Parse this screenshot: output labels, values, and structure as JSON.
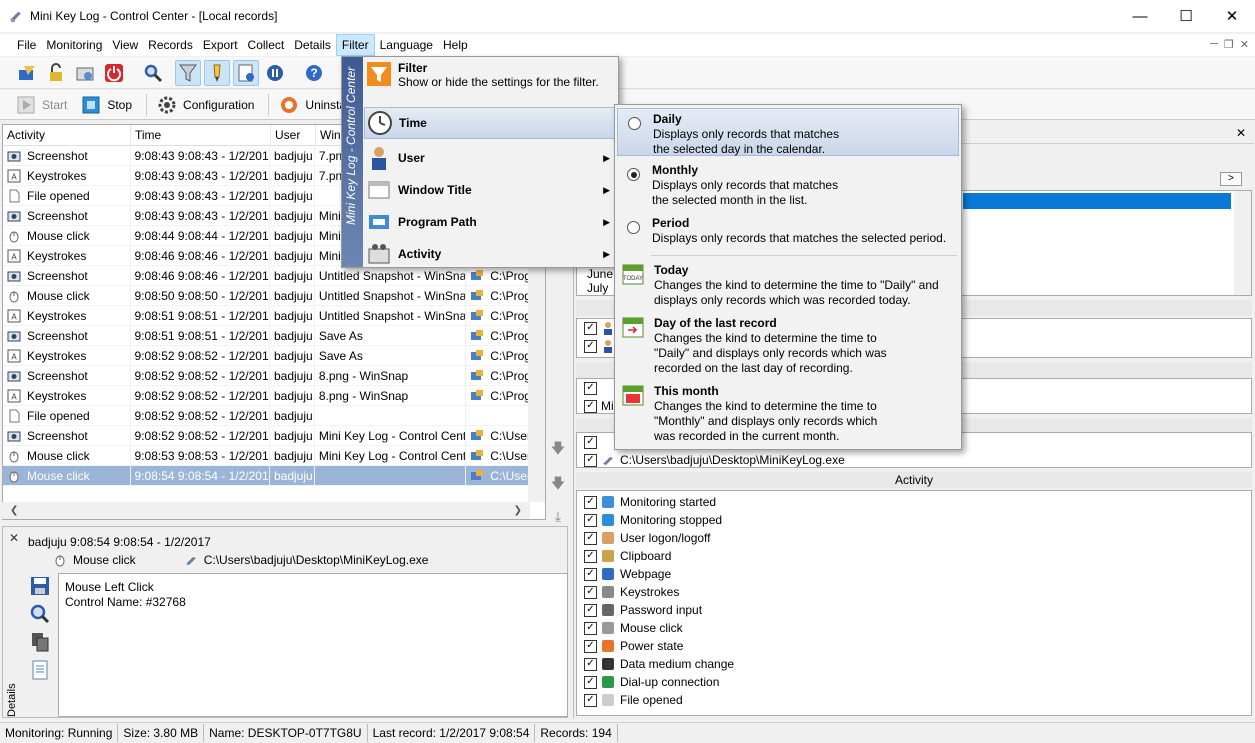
{
  "window": {
    "title": "Mini Key Log - Control Center - [Local records]"
  },
  "menubar": [
    "File",
    "Monitoring",
    "View",
    "Records",
    "Export",
    "Collect",
    "Details",
    "Filter",
    "Language",
    "Help"
  ],
  "toolbar2": {
    "start": "Start",
    "stop": "Stop",
    "configuration": "Configuration",
    "uninstall": "Uninsta"
  },
  "records": {
    "columns": [
      "Activity",
      "Time",
      "User",
      "Win"
    ],
    "rows": [
      {
        "activity": "Screenshot",
        "icon": "screenshot",
        "time": "9:08:43 9:08:43 - 1/2/2017",
        "user": "badjuju",
        "window": "7.pn",
        "path": ""
      },
      {
        "activity": "Keystrokes",
        "icon": "keystrokes",
        "time": "9:08:43 9:08:43 - 1/2/2017",
        "user": "badjuju",
        "window": "7.pn",
        "path": ""
      },
      {
        "activity": "File opened",
        "icon": "file",
        "time": "9:08:43 9:08:43 - 1/2/2017",
        "user": "badjuju",
        "window": "",
        "path": ""
      },
      {
        "activity": "Screenshot",
        "icon": "screenshot",
        "time": "9:08:43 9:08:43 - 1/2/2017",
        "user": "badjuju",
        "window": "Mini",
        "path": ""
      },
      {
        "activity": "Mouse click",
        "icon": "mouse",
        "time": "9:08:44 9:08:44 - 1/2/2017",
        "user": "badjuju",
        "window": "Mini",
        "path": ""
      },
      {
        "activity": "Keystrokes",
        "icon": "keystrokes",
        "time": "9:08:46 9:08:46 - 1/2/2017",
        "user": "badjuju",
        "window": "Mini",
        "path": ""
      },
      {
        "activity": "Screenshot",
        "icon": "screenshot",
        "time": "9:08:46 9:08:46 - 1/2/2017",
        "user": "badjuju",
        "window": "Untitled Snapshot - WinSnap",
        "path": "C:\\Prog"
      },
      {
        "activity": "Mouse click",
        "icon": "mouse",
        "time": "9:08:50 9:08:50 - 1/2/2017",
        "user": "badjuju",
        "window": "Untitled Snapshot - WinSnap",
        "path": "C:\\Prog"
      },
      {
        "activity": "Keystrokes",
        "icon": "keystrokes",
        "time": "9:08:51 9:08:51 - 1/2/2017",
        "user": "badjuju",
        "window": "Untitled Snapshot - WinSnap",
        "path": "C:\\Prog"
      },
      {
        "activity": "Screenshot",
        "icon": "screenshot",
        "time": "9:08:51 9:08:51 - 1/2/2017",
        "user": "badjuju",
        "window": "Save As",
        "path": "C:\\Prog"
      },
      {
        "activity": "Keystrokes",
        "icon": "keystrokes",
        "time": "9:08:52 9:08:52 - 1/2/2017",
        "user": "badjuju",
        "window": "Save As",
        "path": "C:\\Prog"
      },
      {
        "activity": "Screenshot",
        "icon": "screenshot",
        "time": "9:08:52 9:08:52 - 1/2/2017",
        "user": "badjuju",
        "window": "8.png - WinSnap",
        "path": "C:\\Prog"
      },
      {
        "activity": "Keystrokes",
        "icon": "keystrokes",
        "time": "9:08:52 9:08:52 - 1/2/2017",
        "user": "badjuju",
        "window": "8.png - WinSnap",
        "path": "C:\\Prog"
      },
      {
        "activity": "File opened",
        "icon": "file",
        "time": "9:08:52 9:08:52 - 1/2/2017",
        "user": "badjuju",
        "window": "",
        "path": ""
      },
      {
        "activity": "Screenshot",
        "icon": "screenshot",
        "time": "9:08:52 9:08:52 - 1/2/2017",
        "user": "badjuju",
        "window": "Mini Key Log - Control Cent",
        "path": "C:\\User"
      },
      {
        "activity": "Mouse click",
        "icon": "mouse",
        "time": "9:08:53 9:08:53 - 1/2/2017",
        "user": "badjuju",
        "window": "Mini Key Log - Control Cent",
        "path": "C:\\User"
      },
      {
        "activity": "Mouse click",
        "icon": "mouse",
        "time": "9:08:54 9:08:54 - 1/2/2017",
        "user": "badjuju",
        "window": "",
        "path": "C:\\User"
      }
    ]
  },
  "details": {
    "line1": "badjuju   9:08:54 9:08:54  - 1/2/2017",
    "activity": "Mouse click",
    "path": "C:\\Users\\badjuju\\Desktop\\MiniKeyLog.exe",
    "body_line1": "Mouse Left Click",
    "body_line2": "Control Name: #32768",
    "tab": "Details"
  },
  "filter_menu": {
    "band": "Mini Key Log - Control Center",
    "header_title": "Filter",
    "header_sub": "Show or hide the settings for the filter.",
    "items": [
      "Time",
      "User",
      "Window Title",
      "Program Path",
      "Activity"
    ]
  },
  "time_menu": {
    "items": [
      {
        "title": "Daily",
        "sub1": "Displays only records that matches",
        "sub2": "the selected day in the calendar.",
        "sub3": ""
      },
      {
        "title": "Monthly",
        "sub1": "Displays only records that matches",
        "sub2": "the selected month in the list.",
        "sub3": ""
      },
      {
        "title": "Period",
        "sub1": "Displays only records that matches the selected period.",
        "sub2": "",
        "sub3": ""
      },
      {
        "title": "Today",
        "sub1": "Changes the kind to determine the time to \"Daily\" and",
        "sub2": "displays only records which was recorded today.",
        "sub3": ""
      },
      {
        "title": "Day of the last record",
        "sub1": "Changes the kind to determine the time to",
        "sub2": "\"Daily\" and displays only records which was",
        "sub3": "recorded on the last day of recording."
      },
      {
        "title": "This month",
        "sub1": "Changes the kind to determine the time to",
        "sub2": "\"Monthly\" and displays only records which",
        "sub3": "was recorded in the current month."
      }
    ]
  },
  "right_panel": {
    "months": [
      "June",
      "July"
    ],
    "arrow": ">",
    "user_frag": "Mini",
    "path_row": "C:\\Users\\badjuju\\Desktop\\MiniKeyLog.exe",
    "activity_header": "Activity",
    "activities": [
      "Monitoring started",
      "Monitoring stopped",
      "User logon/logoff",
      "Clipboard",
      "Webpage",
      "Keystrokes",
      "Password input",
      "Mouse click",
      "Power state",
      "Data medium change",
      "Dial-up connection",
      "File opened"
    ]
  },
  "status": {
    "monitoring": "Monitoring: Running",
    "size": "Size: 3.80 MB",
    "name": "Name: DESKTOP-0T7TG8U",
    "last": "Last record: 1/2/2017 9:08:54",
    "records": "Records: 194"
  },
  "colors": {
    "selection": "#9bb5d9",
    "menu_band": "#3e5b91",
    "list_selection": "#0a78d7"
  }
}
